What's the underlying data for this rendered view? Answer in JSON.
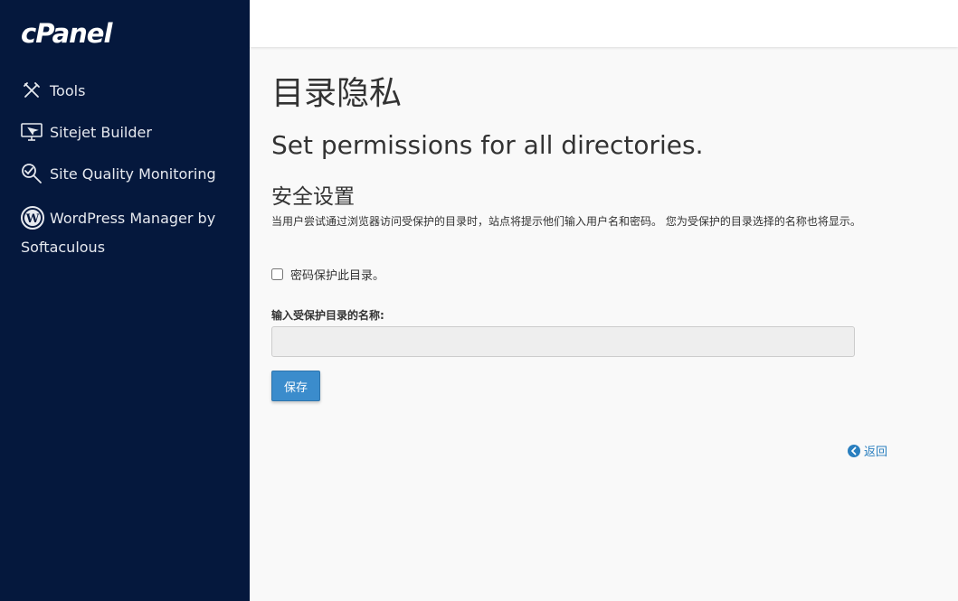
{
  "sidebar": {
    "logo": "cPanel",
    "items": [
      {
        "label": "Tools",
        "icon": "tools-icon"
      },
      {
        "label": "Sitejet Builder",
        "icon": "monitor-icon"
      },
      {
        "label": "Site Quality Monitoring",
        "icon": "magnifier-icon"
      },
      {
        "label": "WordPress Manager by Softaculous",
        "icon": "wordpress-icon"
      }
    ]
  },
  "main": {
    "title": "目录隐私",
    "subtitle": "Set permissions for all directories.",
    "section_title": "安全设置",
    "description": "当用户尝试通过浏览器访问受保护的目录时，站点将提示他们输入用户名和密码。 您为受保护的目录选择的名称也将显示。",
    "checkbox_label": "密码保护此目录。",
    "field_label": "输入受保护目录的名称:",
    "field_value": "",
    "save_label": "保存",
    "back_label": "返回"
  },
  "colors": {
    "sidebar_bg": "#05183d",
    "accent": "#3b8ccc",
    "link": "#2a7fbf"
  }
}
